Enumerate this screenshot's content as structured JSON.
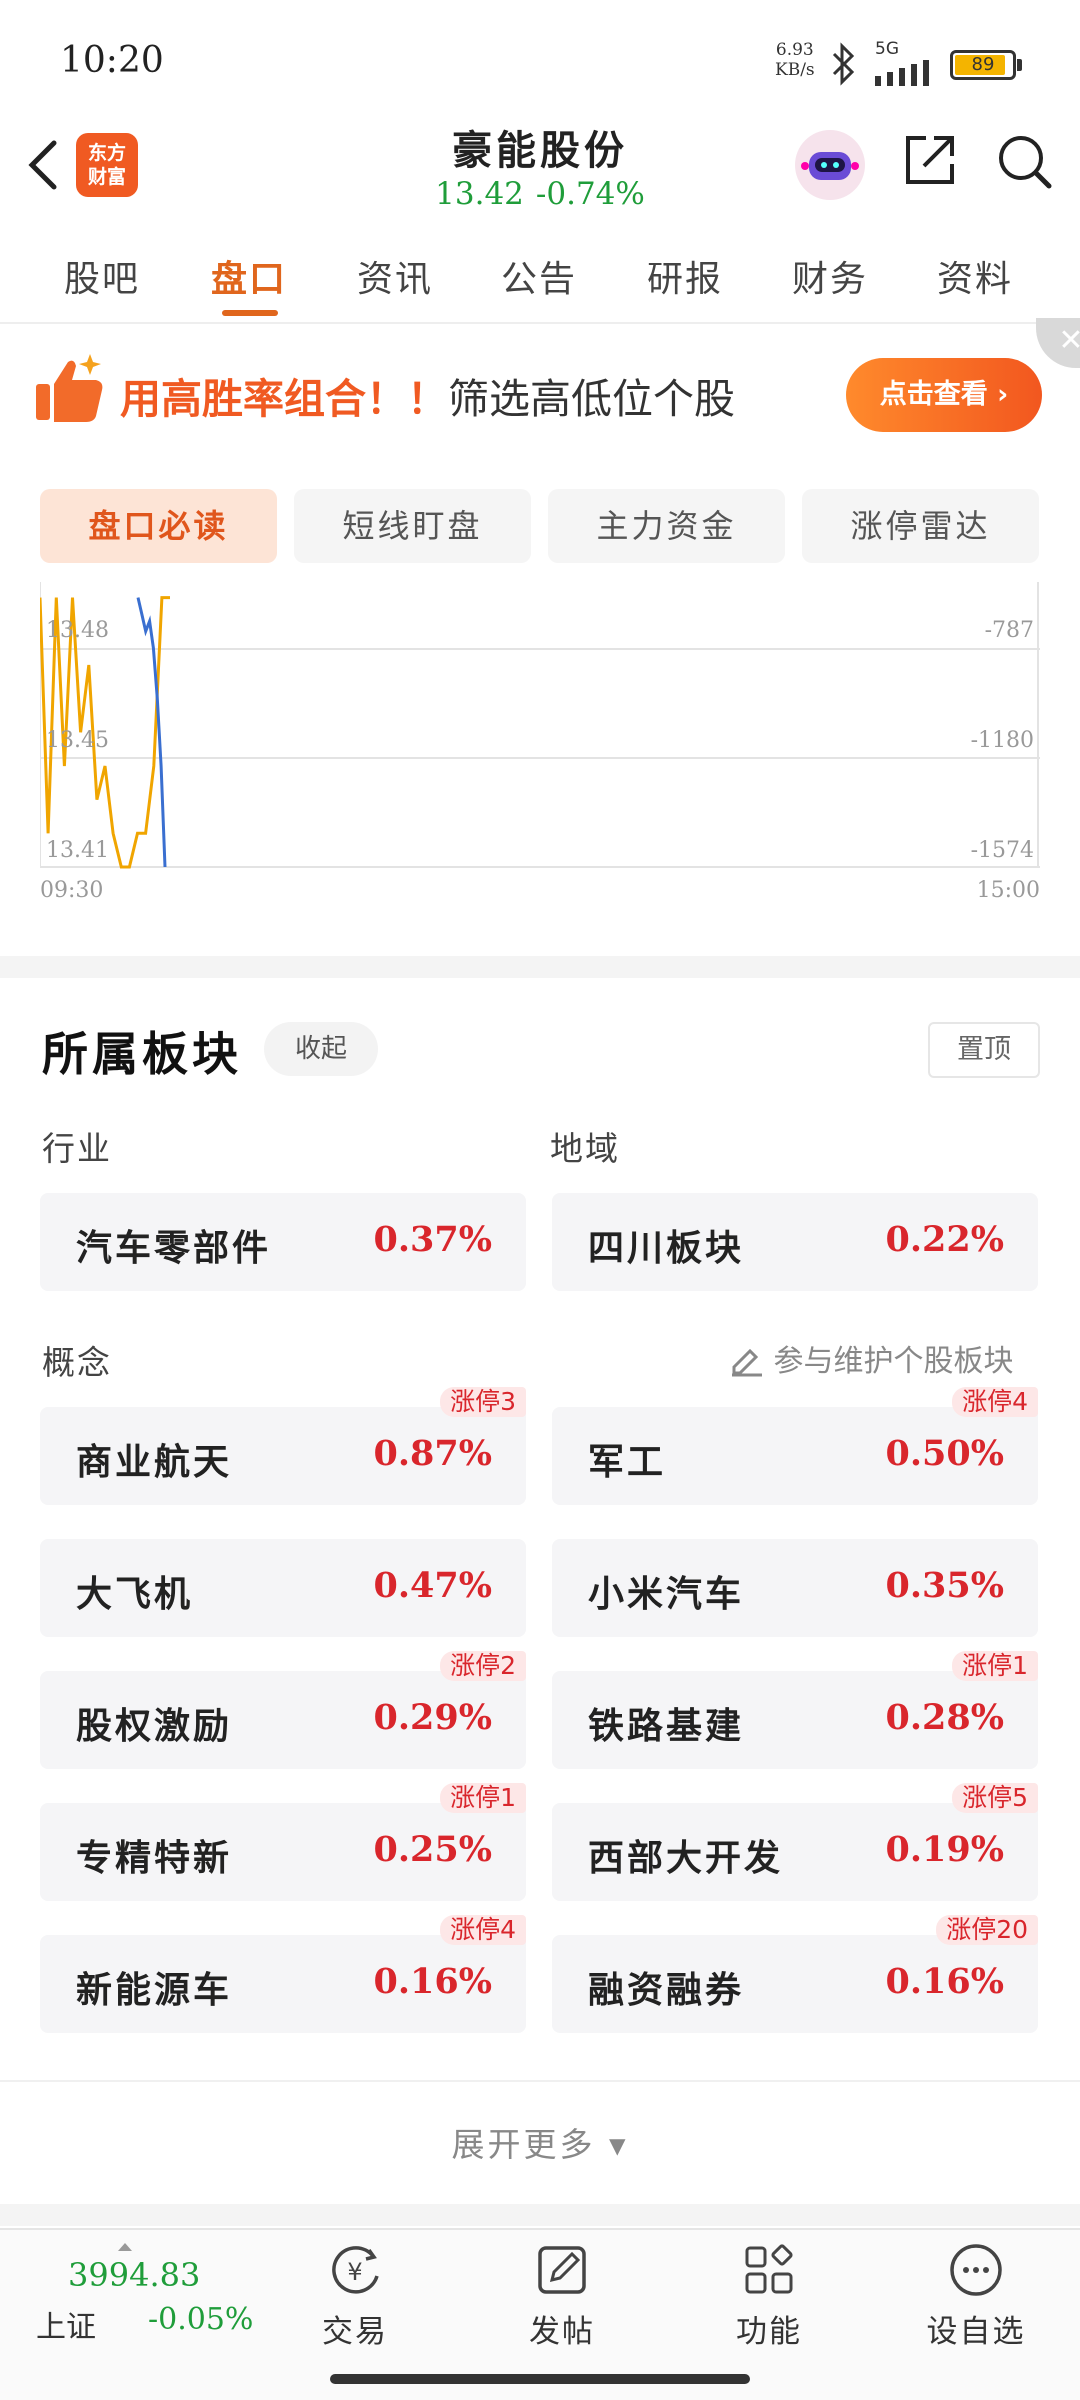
{
  "status": {
    "time": "10:20",
    "net_speed_value": "6.93",
    "net_speed_unit": "KB/s",
    "signal_label": "5G",
    "battery": "89",
    "battery_level": 0.89
  },
  "header": {
    "app_logo": "东方财富",
    "title": "豪能股份",
    "price": "13.42",
    "change_pct": "-0.74%"
  },
  "tabs": [
    "股吧",
    "盘口",
    "资讯",
    "公告",
    "研报",
    "财务",
    "资料"
  ],
  "banner": {
    "text_highlight": "用高胜率组合！！",
    "text_rest": "筛选高低位个股",
    "button": "点击查看 ›"
  },
  "subtabs": [
    "盘口必读",
    "短线盯盘",
    "主力资金",
    "涨停雷达"
  ],
  "chart_data": {
    "type": "line",
    "y_left_ticks": [
      "13.48",
      "13.45",
      "13.41"
    ],
    "y_right_ticks": [
      "-787",
      "-1180",
      "-1574"
    ],
    "x_ticks": [
      "09:30",
      "15:00"
    ],
    "ylim": [
      13.41,
      13.48
    ],
    "grid": true,
    "series": [
      {
        "color": "#f0a500",
        "values": [
          13.49,
          13.42,
          13.49,
          13.44,
          13.49,
          13.45,
          13.47,
          13.43,
          13.44,
          13.42,
          13.41,
          13.41,
          13.42,
          13.42,
          13.44,
          13.49,
          13.49
        ]
      },
      {
        "color": "#3a6fd0",
        "values": [
          13.49,
          13.485,
          13.48,
          13.483,
          13.475,
          13.46,
          13.44,
          13.41
        ]
      }
    ]
  },
  "sector": {
    "title": "所属板块",
    "collapse": "收起",
    "pin": "置顶",
    "industry_label": "行业",
    "region_label": "地域",
    "concept_label": "概念",
    "maintain_link": "参与维护个股板块",
    "industry": {
      "name": "汽车零部件",
      "pct": "0.37%"
    },
    "region": {
      "name": "四川板块",
      "pct": "0.22%"
    },
    "concepts": [
      {
        "name": "商业航天",
        "pct": "0.87%",
        "badge": "涨停3"
      },
      {
        "name": "军工",
        "pct": "0.50%",
        "badge": "涨停4"
      },
      {
        "name": "大飞机",
        "pct": "0.47%",
        "badge": ""
      },
      {
        "name": "小米汽车",
        "pct": "0.35%",
        "badge": ""
      },
      {
        "name": "股权激励",
        "pct": "0.29%",
        "badge": "涨停2"
      },
      {
        "name": "铁路基建",
        "pct": "0.28%",
        "badge": "涨停1"
      },
      {
        "name": "专精特新",
        "pct": "0.25%",
        "badge": "涨停1"
      },
      {
        "name": "西部大开发",
        "pct": "0.19%",
        "badge": "涨停5"
      },
      {
        "name": "新能源车",
        "pct": "0.16%",
        "badge": "涨停4"
      },
      {
        "name": "融资融券",
        "pct": "0.16%",
        "badge": "涨停20"
      }
    ],
    "expand_more": "展开更多 ▾"
  },
  "bottom_nav": {
    "index_value": "3994.83",
    "index_name": "上证",
    "index_change": "-0.05%",
    "items": [
      {
        "label": "交易",
        "icon": "trade-icon"
      },
      {
        "label": "发帖",
        "icon": "post-icon"
      },
      {
        "label": "功能",
        "icon": "apps-icon"
      },
      {
        "label": "设自选",
        "icon": "more-icon"
      }
    ]
  }
}
